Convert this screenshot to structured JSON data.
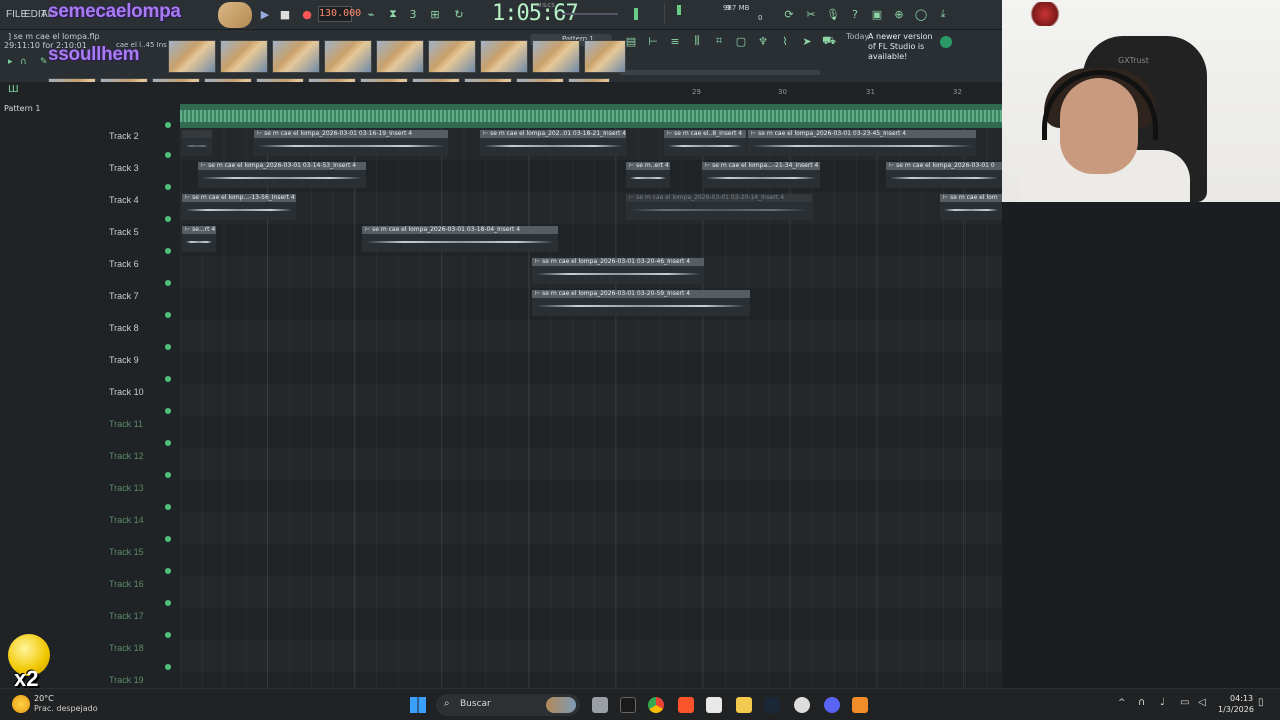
{
  "menu": [
    "FILE",
    "EDIT",
    "AD"
  ],
  "overlay": {
    "title": "semecaelompa",
    "subtitle": "ssoullhem"
  },
  "transport": {
    "tempo": "130.000",
    "time": "1:05:67",
    "time_label": "M:S:CS",
    "cpu": "9",
    "memory": "987 MB",
    "polyphony": "0"
  },
  "project": {
    "name": "] se m cae el lompa.flp",
    "time": "29:11:10 for 2:10:01",
    "hint": "cae el l..45 Ins"
  },
  "news": {
    "date": "Today",
    "text": "A newer version of FL Studio is available!"
  },
  "pattern_selector": "Pattern 1",
  "pattern_label": "Pattern 1",
  "ruler": [
    "29",
    "30",
    "31",
    "32"
  ],
  "tracks": [
    "Track 2",
    "Track 3",
    "Track 4",
    "Track 5",
    "Track 6",
    "Track 7",
    "Track 8",
    "Track 9",
    "Track 10",
    "Track 11",
    "Track 12",
    "Track 13",
    "Track 14",
    "Track 15",
    "Track 16",
    "Track 17",
    "Track 18",
    "Track 19"
  ],
  "clips": [
    {
      "track": 0,
      "label": "",
      "muted": true
    },
    {
      "track": 0,
      "label": "se m cae el lompa_2026-03-01 03-16-19_Insert 4"
    },
    {
      "track": 0,
      "label": "se m cae el lompa_202..01 03-18-21_Insert 4"
    },
    {
      "track": 0,
      "label": "se m cae el..8_Insert 4"
    },
    {
      "track": 0,
      "label": "se m cae el lompa_2026-03-01 03-23-45_Insert 4"
    },
    {
      "track": 1,
      "label": "se m cae el lompa_2026-03-01 03-14-53_Insert 4"
    },
    {
      "track": 1,
      "label": "se m..ert 4"
    },
    {
      "track": 1,
      "label": "se m cae el lompa...-21-34_Insert 4"
    },
    {
      "track": 1,
      "label": "se m cae el lompa_2026-03-01 0"
    },
    {
      "track": 2,
      "label": "se m cae el lomp...-13-56_Insert 4"
    },
    {
      "track": 2,
      "label": "se m cae el lompa_2026-03-01 03-20-14_Insert 4",
      "muted": true
    },
    {
      "track": 2,
      "label": "se m cae el lom"
    },
    {
      "track": 3,
      "label": "se...rt 4"
    },
    {
      "track": 3,
      "label": "se m cae el lompa_2026-03-01 03-18-04_Insert 4"
    },
    {
      "track": 4,
      "label": "se m cae el lompa_2026-03-01 03-20-46_Insert 4"
    },
    {
      "track": 5,
      "label": "se m cae el lompa_2026-03-01 03-20-59_Insert 4"
    }
  ],
  "webcam": {
    "chair_brand": "GXTrust"
  },
  "sticker": {
    "text": "x2"
  },
  "taskbar": {
    "weather_temp": "20°C",
    "weather_desc": "Prac. despejado",
    "search_placeholder": "Buscar",
    "clock_time": "04:13",
    "clock_date": "1/3/2026"
  },
  "colors": {
    "accent_green": "#4fc07a",
    "waveform_green": "#2f6a51",
    "overlay_purple": "#a77cf0",
    "tempo_orange": "#ff8a6b"
  }
}
